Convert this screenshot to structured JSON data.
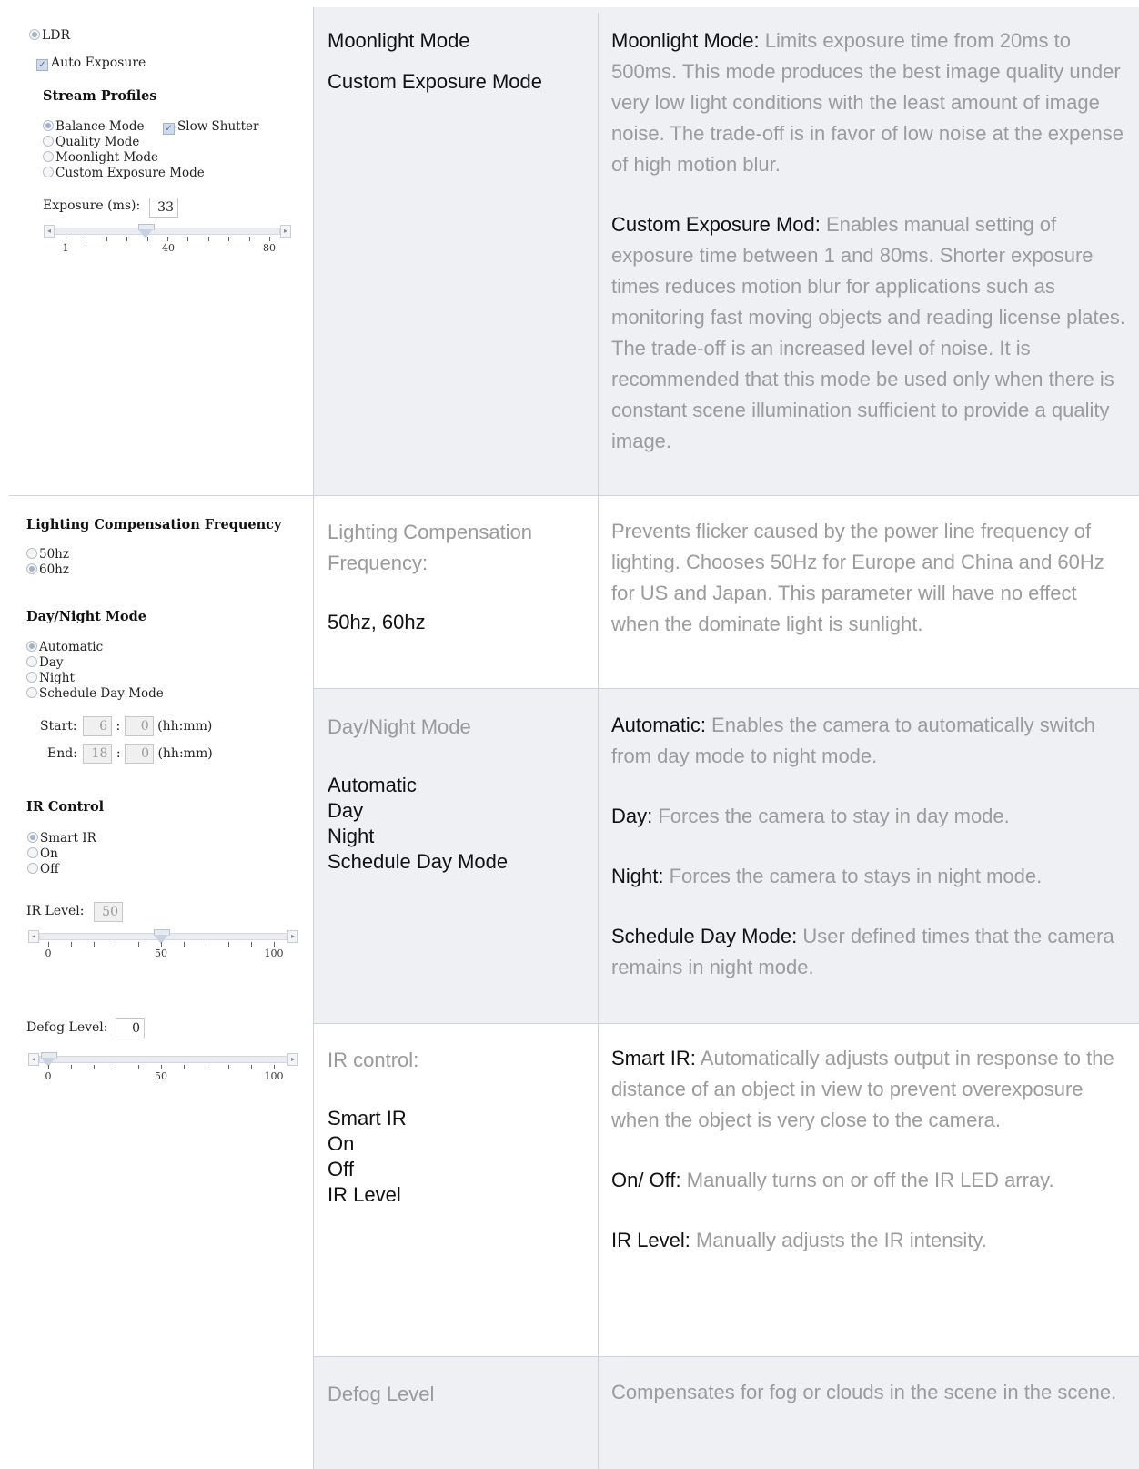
{
  "left_panel_1": {
    "ldr_label": "LDR",
    "auto_exposure_label": "Auto Exposure",
    "stream_profiles_heading": "Stream Profiles",
    "balance_mode": "Balance Mode",
    "slow_shutter": "Slow Shutter",
    "quality_mode": "Quality Mode",
    "moonlight_mode": "Moonlight Mode",
    "custom_exposure_mode": "Custom Exposure Mode",
    "exposure_label": "Exposure (ms):",
    "exposure_value": "33",
    "slider_labels": [
      "1",
      "40",
      "80"
    ]
  },
  "left_panel_2": {
    "lcf_heading": "Lighting Compensation Frequency",
    "hz50": "50hz",
    "hz60": "60hz",
    "daynight_heading": "Day/Night Mode",
    "automatic": "Automatic",
    "day": "Day",
    "night": "Night",
    "schedule_day_mode": "Schedule Day Mode",
    "start_label": "Start:",
    "start_hh": "6",
    "start_mm": "0",
    "end_label": "End:",
    "end_hh": "18",
    "end_mm": "0",
    "colon": ":",
    "hhmm": "(hh:mm)",
    "ir_heading": "IR Control",
    "smart_ir": "Smart IR",
    "on": "On",
    "off": "Off",
    "ir_level_label": "IR Level:",
    "ir_level_value": "50",
    "ir_slider_labels": [
      "0",
      "50",
      "100"
    ],
    "defog_label": "Defog Level:",
    "defog_value": "0",
    "defog_slider_labels": [
      "0",
      "50",
      "100"
    ]
  },
  "rows": {
    "exposure": {
      "mid_1": "Moonlight Mode",
      "mid_2": "Custom Exposure Mode",
      "desc_1_term": "Moonlight Mode:",
      "desc_1_text": " Limits exposure time from 20ms to 500ms. This mode produces the best image quality under very low light conditions with the least amount of image noise. The trade-off is in favor of low noise at the expense of high motion blur.",
      "desc_2_term": "Custom Exposure Mod:",
      "desc_2_text": " Enables manual setting of exposure time between 1 and 80ms. Shorter exposure times reduces motion blur for applications such as monitoring fast moving objects and reading license plates. The trade-off is an increased level of noise. It is recommended that this mode be used only when there is constant scene illumination sufficient to provide a quality image."
    },
    "lcf": {
      "mid_title": "Lighting Compensation Frequency:",
      "mid_values": "50hz, 60hz",
      "desc": "Prevents flicker caused by the power line frequency of lighting. Chooses 50Hz for Europe and China and 60Hz for US and Japan. This parameter will have no effect when the dominate light is sunlight."
    },
    "daynight": {
      "mid_title": "Day/Night Mode",
      "mid_values": [
        "Automatic",
        "Day",
        "Night",
        "Schedule Day Mode"
      ],
      "desc": [
        {
          "term": "Automatic:",
          "text": " Enables the camera to automatically switch from day mode to night mode."
        },
        {
          "term": "Day:",
          "text": " Forces the camera to stay in day mode."
        },
        {
          "term": "Night:",
          "text": " Forces the camera to stays in night mode."
        },
        {
          "term": "Schedule Day Mode:",
          "text": " User defined times that the camera remains in night mode."
        }
      ]
    },
    "ir": {
      "mid_title": "IR control:",
      "mid_values": [
        "Smart IR",
        "On",
        "Off",
        "IR Level"
      ],
      "desc": [
        {
          "term": "Smart IR:",
          "text": " Automatically adjusts output in response to the distance of an object in view to prevent overexposure when the object is very close to the camera."
        },
        {
          "term": "On/ Off:",
          "text": " Manually turns on or off the IR LED array."
        },
        {
          "term": "IR Level:",
          "text": " Manually adjusts the IR intensity."
        }
      ]
    },
    "defog": {
      "mid_title": "Defog Level",
      "desc": "Compensates for fog or clouds in the scene in the scene."
    }
  },
  "sliders": {
    "exposure_ms": 33,
    "ir_level": 50,
    "defog_level": 0
  }
}
